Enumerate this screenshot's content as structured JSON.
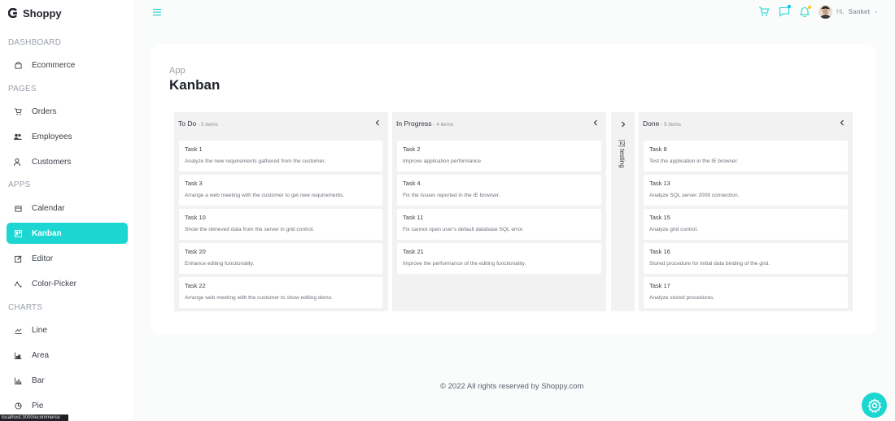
{
  "brand": {
    "label": "Shoppy"
  },
  "sidebar": {
    "sections": [
      {
        "label": "DASHBOARD",
        "items": [
          {
            "label": "Ecommerce",
            "icon": "shopping-bag-icon"
          }
        ]
      },
      {
        "label": "PAGES",
        "items": [
          {
            "label": "Orders",
            "icon": "cart-icon"
          },
          {
            "label": "Employees",
            "icon": "people-icon"
          },
          {
            "label": "Customers",
            "icon": "user-icon"
          }
        ]
      },
      {
        "label": "APPS",
        "items": [
          {
            "label": "Calendar",
            "icon": "calendar-icon"
          },
          {
            "label": "Kanban",
            "icon": "kanban-icon",
            "active": true
          },
          {
            "label": "Editor",
            "icon": "edit-icon"
          },
          {
            "label": "Color-Picker",
            "icon": "color-picker-icon"
          }
        ]
      },
      {
        "label": "CHARTS",
        "items": [
          {
            "label": "Line",
            "icon": "line-chart-icon"
          },
          {
            "label": "Area",
            "icon": "area-chart-icon"
          },
          {
            "label": "Bar",
            "icon": "bar-chart-icon"
          },
          {
            "label": "Pie",
            "icon": "pie-chart-icon"
          }
        ]
      }
    ]
  },
  "statusbar": {
    "url": "localhost:3000/ecommerce"
  },
  "topbar": {
    "greeting": "Hi,",
    "user_name": "Sanket",
    "icons": [
      "menu-icon",
      "cart-icon",
      "chat-icon",
      "bell-icon",
      "chevron-down-icon"
    ]
  },
  "page": {
    "breadcrumb": "App",
    "title": "Kanban"
  },
  "kanban": {
    "columns": [
      {
        "title": "To Do",
        "count": " - 5 items",
        "tasks": [
          {
            "title": "Task 1",
            "summary": "Analyze the new requirements gathered from the customer."
          },
          {
            "title": "Task 3",
            "summary": "Arrange a web meeting with the customer to get new requirements."
          },
          {
            "title": "Task 10",
            "summary": "Show the retrieved data from the server in grid control."
          },
          {
            "title": "Task 20",
            "summary": "Enhance editing functionality."
          },
          {
            "title": "Task 22",
            "summary": "Arrange web meeting with the customer to show editing demo."
          }
        ]
      },
      {
        "title": "In Progress",
        "count": " - 4 items",
        "tasks": [
          {
            "title": "Task 2",
            "summary": "Improve application performance"
          },
          {
            "title": "Task 4",
            "summary": "Fix the issues reported in the IE browser."
          },
          {
            "title": "Task 11",
            "summary": "Fix cannot open user's default database SQL error."
          },
          {
            "title": "Task 21",
            "summary": "Improve the performance of the editing functionality."
          }
        ]
      },
      {
        "title": "Done",
        "count": " - 5 items",
        "tasks": [
          {
            "title": "Task 8",
            "summary": "Test the application in the IE browser."
          },
          {
            "title": "Task 13",
            "summary": "Analyze SQL server 2008 connection."
          },
          {
            "title": "Task 15",
            "summary": "Analyze grid control."
          },
          {
            "title": "Task 16",
            "summary": "Stored procedure for initial data binding of the grid."
          },
          {
            "title": "Task 17",
            "summary": "Analyze stored procedures."
          }
        ]
      }
    ],
    "collapsed_column": {
      "label": "[2] testing"
    }
  },
  "footer": {
    "text": "© 2022 All rights reserved by Shoppy.com"
  },
  "colors": {
    "accent": "#1cd7d1",
    "chat_dot": "#03c9d7",
    "bell_dot": "#fec90f"
  }
}
